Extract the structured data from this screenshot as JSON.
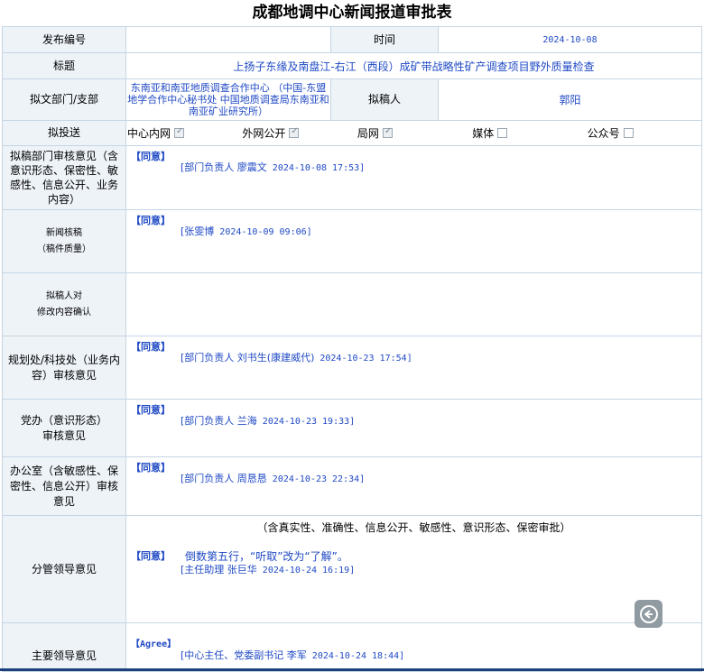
{
  "title": "成都地调中心新闻报道审批表",
  "fields": {
    "pub_no_label": "发布编号",
    "pub_no_value": "",
    "time_label": "时间",
    "time_value": "2024-10-08",
    "subject_label": "标题",
    "subject_value": "上扬子东缘及南盘江-右江（西段）成矿带战略性矿产调查项目野外质量检查",
    "dept_label": "拟文部门/支部",
    "dept_value": "东南亚和南亚地质调查合作中心 （中国-东盟地学合作中心秘书处 中国地质调查局东南亚和南亚矿业研究所）",
    "drafter_label": "拟稿人",
    "drafter_value": "郭阳",
    "send_label": "拟投送",
    "send_options": [
      {
        "label": "中心内网",
        "checked": true
      },
      {
        "label": "外网公开",
        "checked": true
      },
      {
        "label": "局网",
        "checked": true
      },
      {
        "label": "媒体",
        "checked": false
      },
      {
        "label": "公众号",
        "checked": false
      }
    ]
  },
  "reviews": [
    {
      "label": "拟稿部门审核意见（含意识形态、保密性、敏感性、信息公开、业务内容）",
      "agree": "【同意】",
      "signer": "[部门负责人 廖震文",
      "time": "2024-10-08 17:53]"
    },
    {
      "label_line1": "新闻核稿",
      "label_line2": "（稿件质量）",
      "agree": "【同意】",
      "signer": "[张雯博",
      "time": "2024-10-09 09:06]"
    },
    {
      "label_line1": "拟稿人对",
      "label_line2": "修改内容确认"
    },
    {
      "label": "规划处/科技处（业务内容）审核意见",
      "agree": "【同意】",
      "signer": "[部门负责人 刘书生(康建威代)",
      "time": "2024-10-23 17:54]"
    },
    {
      "label": "党办（意识形态）审核意见",
      "agree": "【同意】",
      "signer": "[部门负责人 兰海",
      "time": "2024-10-23 19:33]"
    },
    {
      "label": "办公室（含敏感性、保密性、信息公开）审核意见",
      "agree": "【同意】",
      "signer": "[部门负责人 周恳恳",
      "time": "2024-10-23 22:34]"
    }
  ],
  "leader": {
    "label": "分管领导意见",
    "scope": "（含真实性、准确性、信息公开、敏感性、意识形态、保密审批）",
    "agree": "【同意】",
    "comment": "倒数第五行，“听取”改为“了解”。",
    "signer": "[主任助理 张巨华",
    "time": "2024-10-24 16:19]"
  },
  "main_leader": {
    "label": "主要领导意见",
    "agree": "【Agree】",
    "signer": "[中心主任、党委副书记 李军",
    "time": "2024-10-24 18:44]"
  },
  "colors": {
    "text_blue": "#1f49c4",
    "border": "#c5d5e3",
    "label_bg": "#eef3f8"
  },
  "icons": {
    "fab": "reply-icon",
    "checkbox": "checkbox"
  }
}
